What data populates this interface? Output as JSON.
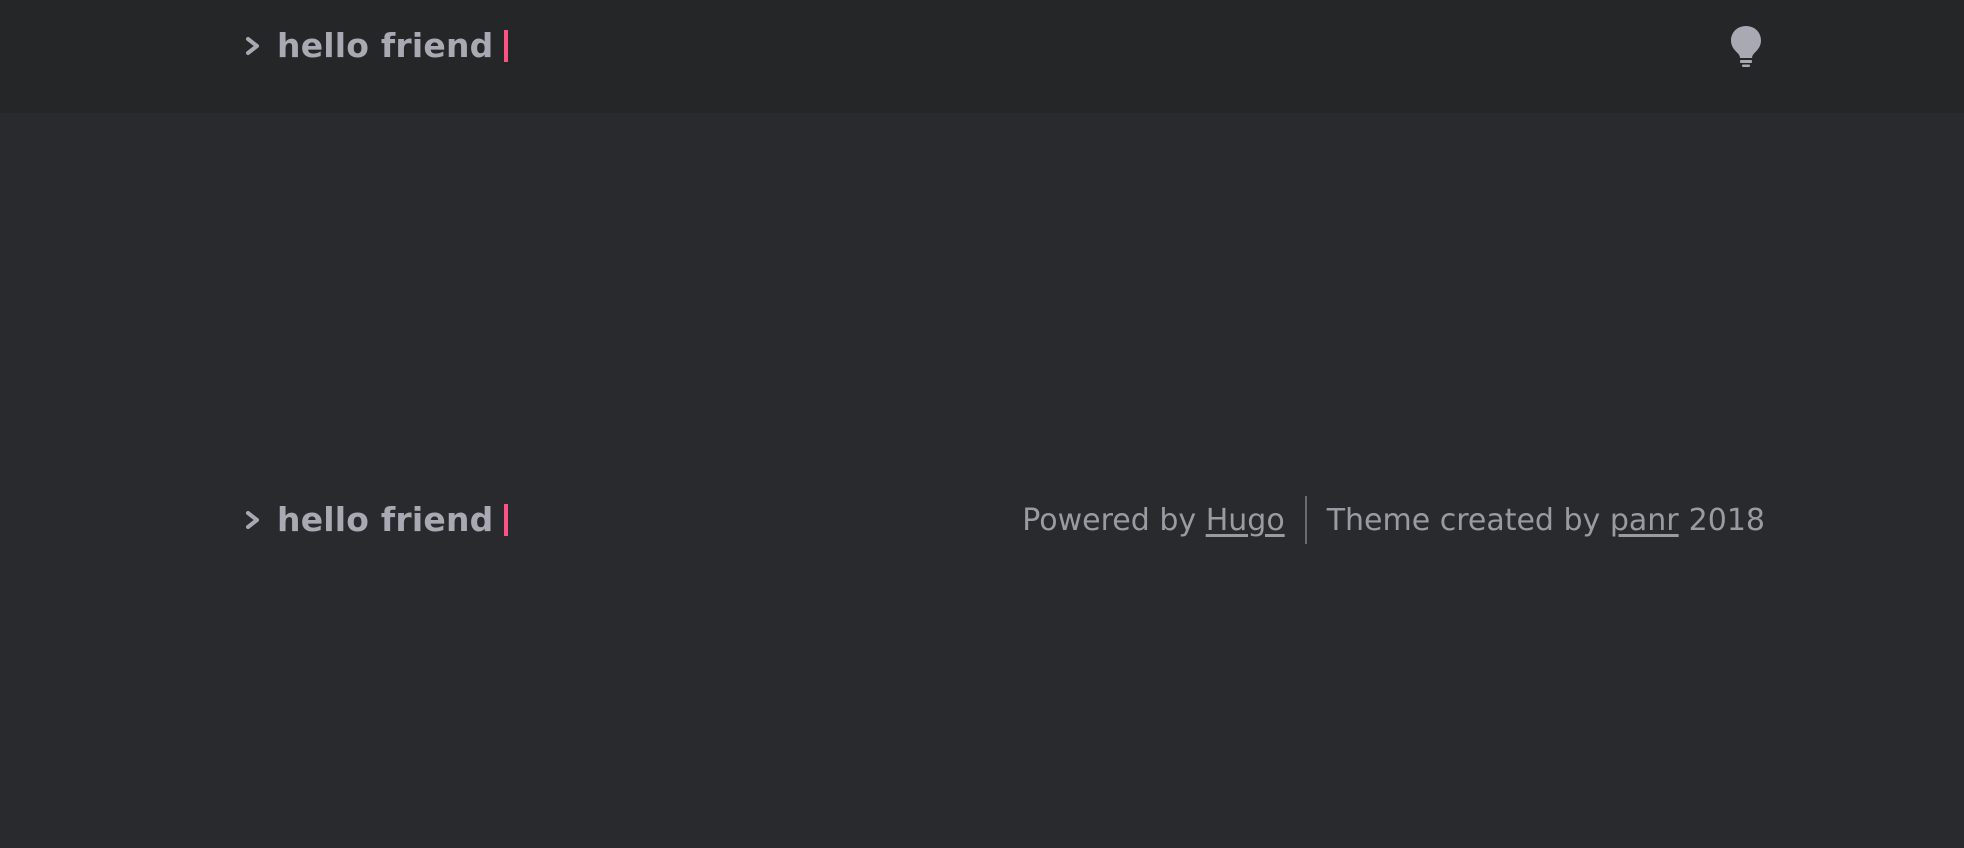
{
  "header": {
    "logo_text": "hello friend",
    "theme_toggle_icon": "lightbulb-icon"
  },
  "footer": {
    "logo_text": "hello friend",
    "powered_by_prefix": "Powered by",
    "powered_by_link": "Hugo",
    "theme_by_prefix": "Theme created by",
    "theme_by_link": "panr",
    "year": "2018"
  },
  "colors": {
    "background": "#292a2d",
    "header_background": "#252627",
    "text": "#a9a9b3",
    "cursor_accent": "#fe5186"
  }
}
